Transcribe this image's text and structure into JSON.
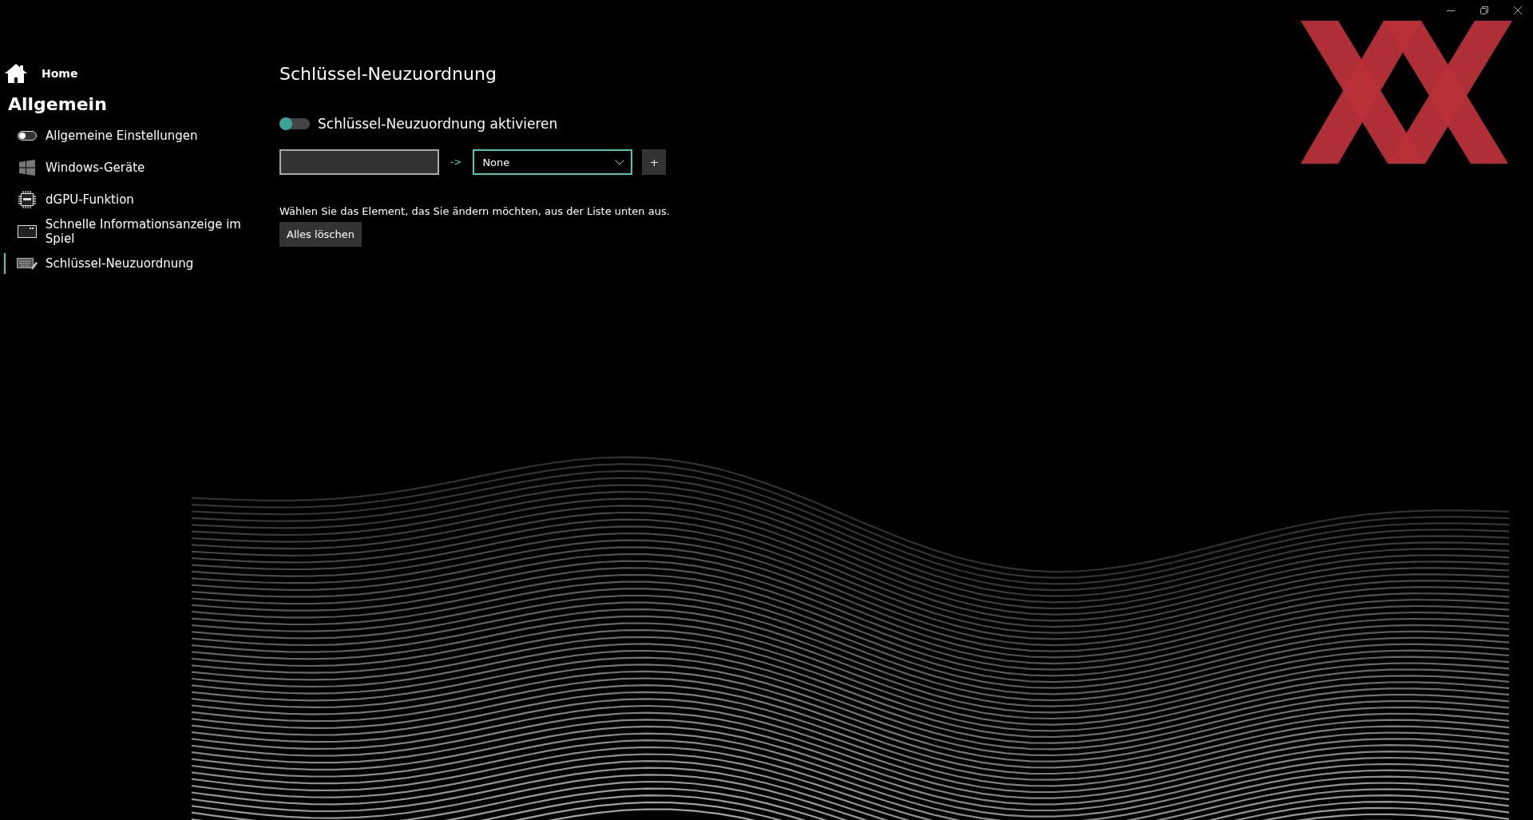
{
  "sidebar": {
    "home": "Home",
    "section": "Allgemein",
    "items": [
      {
        "label": "Allgemeine Einstellungen",
        "kind": "toggle",
        "selected": false
      },
      {
        "label": "Windows-Geräte",
        "kind": "windows",
        "selected": false
      },
      {
        "label": "dGPU-Funktion",
        "kind": "chip",
        "selected": false
      },
      {
        "label": "Schnelle Informationsanzeige im Spiel",
        "kind": "display",
        "selected": false
      },
      {
        "label": "Schlüssel-Neuzuordnung",
        "kind": "keyboard",
        "selected": true
      }
    ]
  },
  "page": {
    "title": "Schlüssel-Neuzuordnung",
    "enable_toggle": {
      "label": "Schlüssel-Neuzuordnung aktivieren",
      "on": false
    },
    "mapping": {
      "arrow": "->",
      "dropdown_value": "None",
      "add_button": "+"
    },
    "instruction": "Wählen Sie das Element, das Sie ändern möchten, aus der Liste unten aus.",
    "clear_button": "Alles löschen"
  }
}
